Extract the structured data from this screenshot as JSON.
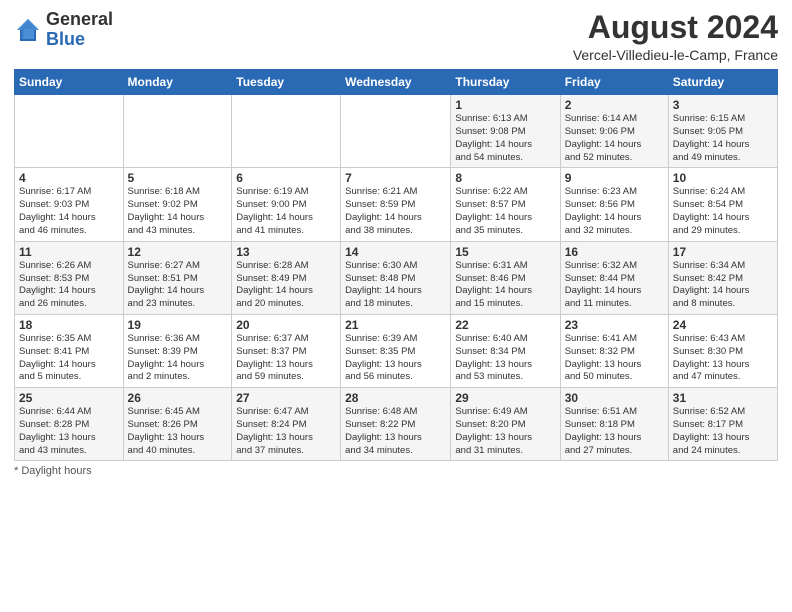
{
  "header": {
    "logo_general": "General",
    "logo_blue": "Blue",
    "month_title": "August 2024",
    "location": "Vercel-Villedieu-le-Camp, France"
  },
  "weekdays": [
    "Sunday",
    "Monday",
    "Tuesday",
    "Wednesday",
    "Thursday",
    "Friday",
    "Saturday"
  ],
  "footnote": "Daylight hours",
  "weeks": [
    [
      {
        "day": "",
        "info": ""
      },
      {
        "day": "",
        "info": ""
      },
      {
        "day": "",
        "info": ""
      },
      {
        "day": "",
        "info": ""
      },
      {
        "day": "1",
        "info": "Sunrise: 6:13 AM\nSunset: 9:08 PM\nDaylight: 14 hours\nand 54 minutes."
      },
      {
        "day": "2",
        "info": "Sunrise: 6:14 AM\nSunset: 9:06 PM\nDaylight: 14 hours\nand 52 minutes."
      },
      {
        "day": "3",
        "info": "Sunrise: 6:15 AM\nSunset: 9:05 PM\nDaylight: 14 hours\nand 49 minutes."
      }
    ],
    [
      {
        "day": "4",
        "info": "Sunrise: 6:17 AM\nSunset: 9:03 PM\nDaylight: 14 hours\nand 46 minutes."
      },
      {
        "day": "5",
        "info": "Sunrise: 6:18 AM\nSunset: 9:02 PM\nDaylight: 14 hours\nand 43 minutes."
      },
      {
        "day": "6",
        "info": "Sunrise: 6:19 AM\nSunset: 9:00 PM\nDaylight: 14 hours\nand 41 minutes."
      },
      {
        "day": "7",
        "info": "Sunrise: 6:21 AM\nSunset: 8:59 PM\nDaylight: 14 hours\nand 38 minutes."
      },
      {
        "day": "8",
        "info": "Sunrise: 6:22 AM\nSunset: 8:57 PM\nDaylight: 14 hours\nand 35 minutes."
      },
      {
        "day": "9",
        "info": "Sunrise: 6:23 AM\nSunset: 8:56 PM\nDaylight: 14 hours\nand 32 minutes."
      },
      {
        "day": "10",
        "info": "Sunrise: 6:24 AM\nSunset: 8:54 PM\nDaylight: 14 hours\nand 29 minutes."
      }
    ],
    [
      {
        "day": "11",
        "info": "Sunrise: 6:26 AM\nSunset: 8:53 PM\nDaylight: 14 hours\nand 26 minutes."
      },
      {
        "day": "12",
        "info": "Sunrise: 6:27 AM\nSunset: 8:51 PM\nDaylight: 14 hours\nand 23 minutes."
      },
      {
        "day": "13",
        "info": "Sunrise: 6:28 AM\nSunset: 8:49 PM\nDaylight: 14 hours\nand 20 minutes."
      },
      {
        "day": "14",
        "info": "Sunrise: 6:30 AM\nSunset: 8:48 PM\nDaylight: 14 hours\nand 18 minutes."
      },
      {
        "day": "15",
        "info": "Sunrise: 6:31 AM\nSunset: 8:46 PM\nDaylight: 14 hours\nand 15 minutes."
      },
      {
        "day": "16",
        "info": "Sunrise: 6:32 AM\nSunset: 8:44 PM\nDaylight: 14 hours\nand 11 minutes."
      },
      {
        "day": "17",
        "info": "Sunrise: 6:34 AM\nSunset: 8:42 PM\nDaylight: 14 hours\nand 8 minutes."
      }
    ],
    [
      {
        "day": "18",
        "info": "Sunrise: 6:35 AM\nSunset: 8:41 PM\nDaylight: 14 hours\nand 5 minutes."
      },
      {
        "day": "19",
        "info": "Sunrise: 6:36 AM\nSunset: 8:39 PM\nDaylight: 14 hours\nand 2 minutes."
      },
      {
        "day": "20",
        "info": "Sunrise: 6:37 AM\nSunset: 8:37 PM\nDaylight: 13 hours\nand 59 minutes."
      },
      {
        "day": "21",
        "info": "Sunrise: 6:39 AM\nSunset: 8:35 PM\nDaylight: 13 hours\nand 56 minutes."
      },
      {
        "day": "22",
        "info": "Sunrise: 6:40 AM\nSunset: 8:34 PM\nDaylight: 13 hours\nand 53 minutes."
      },
      {
        "day": "23",
        "info": "Sunrise: 6:41 AM\nSunset: 8:32 PM\nDaylight: 13 hours\nand 50 minutes."
      },
      {
        "day": "24",
        "info": "Sunrise: 6:43 AM\nSunset: 8:30 PM\nDaylight: 13 hours\nand 47 minutes."
      }
    ],
    [
      {
        "day": "25",
        "info": "Sunrise: 6:44 AM\nSunset: 8:28 PM\nDaylight: 13 hours\nand 43 minutes."
      },
      {
        "day": "26",
        "info": "Sunrise: 6:45 AM\nSunset: 8:26 PM\nDaylight: 13 hours\nand 40 minutes."
      },
      {
        "day": "27",
        "info": "Sunrise: 6:47 AM\nSunset: 8:24 PM\nDaylight: 13 hours\nand 37 minutes."
      },
      {
        "day": "28",
        "info": "Sunrise: 6:48 AM\nSunset: 8:22 PM\nDaylight: 13 hours\nand 34 minutes."
      },
      {
        "day": "29",
        "info": "Sunrise: 6:49 AM\nSunset: 8:20 PM\nDaylight: 13 hours\nand 31 minutes."
      },
      {
        "day": "30",
        "info": "Sunrise: 6:51 AM\nSunset: 8:18 PM\nDaylight: 13 hours\nand 27 minutes."
      },
      {
        "day": "31",
        "info": "Sunrise: 6:52 AM\nSunset: 8:17 PM\nDaylight: 13 hours\nand 24 minutes."
      }
    ]
  ]
}
